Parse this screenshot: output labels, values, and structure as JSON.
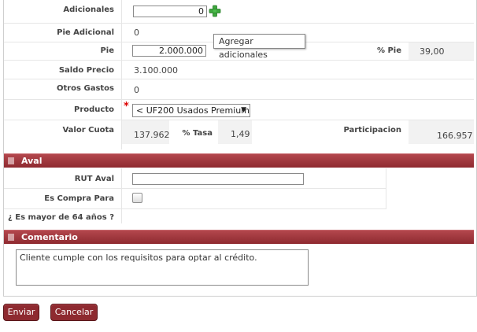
{
  "form": {
    "adicionales": {
      "label": "Adicionales",
      "value": "0"
    },
    "pie_adicional": {
      "label": "Pie Adicional",
      "value": "0"
    },
    "pie": {
      "label": "Pie",
      "value": "2.000.000"
    },
    "pct_pie": {
      "label": "% Pie",
      "value": "39,00"
    },
    "saldo_precio": {
      "label": "Saldo Precio",
      "value": "3.100.000"
    },
    "otros_gastos": {
      "label": "Otros Gastos",
      "value": "0"
    },
    "producto": {
      "label": "Producto",
      "required_mark": "*",
      "selected": "< UF200 Usados Premium"
    },
    "valor_cuota": {
      "label": "Valor Cuota",
      "value": "137.962"
    },
    "pct_tasa": {
      "label": "% Tasa",
      "value": "1,49"
    },
    "participacion": {
      "label": "Participacion",
      "value": "166.957"
    }
  },
  "tooltip": {
    "text": "Agregar adicionales"
  },
  "aval": {
    "title": "Aval",
    "rut_aval": {
      "label": "RUT Aval",
      "value": ""
    },
    "es_compra_para": {
      "label": "Es Compra Para"
    },
    "mayor_64": {
      "label": "¿ Es mayor de 64 años ?"
    }
  },
  "comentario": {
    "title": "Comentario",
    "text": "Cliente cumple con los requisitos para optar al crédito."
  },
  "actions": {
    "enviar": "Enviar",
    "cancelar": "Cancelar"
  },
  "colors": {
    "section_bar": "#8e2a30",
    "button": "#8e2a30",
    "add_icon": "#3fa83f"
  }
}
